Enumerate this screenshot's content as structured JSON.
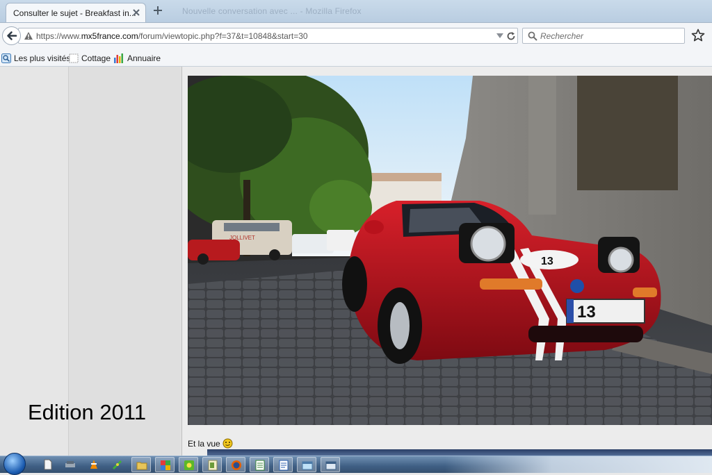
{
  "browser": {
    "tab": {
      "title": "Consulter le sujet - Breakfast in..."
    },
    "ghost_tab_text": "Nouvelle conversation avec ... - Mozilla Firefox",
    "address": {
      "host_prefix": "https://www.",
      "host": "mx5france.com",
      "path": "/forum/viewtopic.php?f=37&t=10848&start=30"
    },
    "search": {
      "placeholder": "Rechercher"
    },
    "bookmarks": [
      {
        "label": "Les plus visités",
        "icon": "most-visited-icon"
      },
      {
        "label": "Cottage",
        "icon": "blank-page-icon"
      },
      {
        "label": "Annuaire",
        "icon": "bar-chart-icon"
      }
    ]
  },
  "page": {
    "sidebar_text": "Edition 2011",
    "caption": "Et la vue",
    "photo_plate": "13",
    "photo_roundel": "13",
    "photo_van_text": "JOLLIVET"
  },
  "taskbar": {
    "items": [
      "start-orb-icon",
      "file-icon",
      "network-icon",
      "vlc-cone-icon",
      "sword-icon",
      "explorer-folder-icon",
      "paint-icon",
      "green-app-icon",
      "notes-icon",
      "firefox-icon",
      "spreadsheet-icon",
      "document-icon",
      "glass-window-icon",
      "window-icon"
    ]
  },
  "colors": {
    "chrome_bg": "#f3f5f8",
    "tabstrip": "#c9daea",
    "car_red": "#c8101c",
    "taskbar": "#3f5f84"
  }
}
